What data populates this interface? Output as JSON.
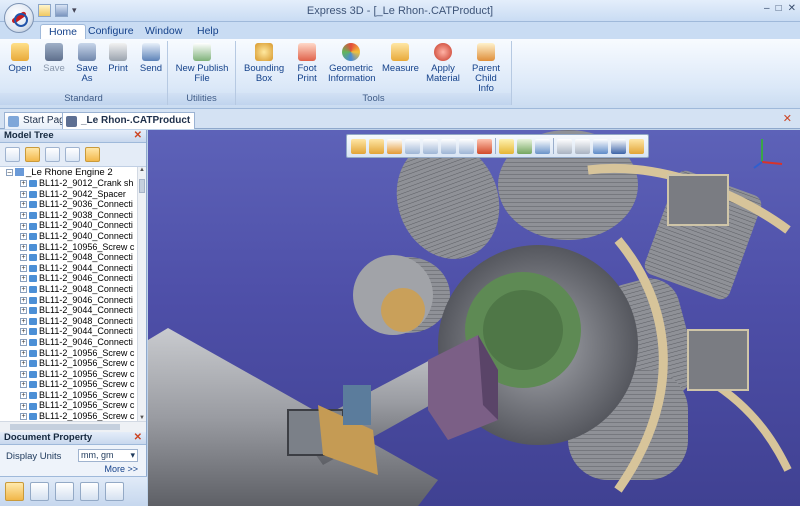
{
  "window": {
    "title": "Express 3D - [_Le Rhon-.CATProduct]",
    "controls": [
      "–",
      "□",
      "✕"
    ]
  },
  "ribbon_tabs": [
    "Home",
    "Configure",
    "Window",
    "Help"
  ],
  "ribbon": {
    "standard": {
      "label": "Standard",
      "buttons": [
        "Open",
        "Save",
        "Save As",
        "Print",
        "Send"
      ]
    },
    "utilities": {
      "label": "Utilities",
      "buttons": [
        "New Publish File"
      ]
    },
    "tools": {
      "label": "Tools",
      "buttons": [
        "Bounding Box",
        "Foot Print",
        "Geometric Information",
        "Measure",
        "Apply Material",
        "Parent Child Info"
      ]
    }
  },
  "doc_tabs": [
    "Start Page",
    "_Le Rhon-.CATProduct"
  ],
  "model_tree": {
    "title": "Model Tree",
    "root": "_Le Rhone Engine 2",
    "items": [
      "BL11-2_9012_Crank sh",
      "BL11-2_9042_Spacer",
      "BL11-2_9036_Connecti",
      "BL11-2_9038_Connecti",
      "BL11-2_9040_Connecti",
      "BL11-2_9040_Connecti",
      "BL11-2_10956_Screw c",
      "BL11-2_9048_Connecti",
      "BL11-2_9044_Connecti",
      "BL11-2_9046_Connecti",
      "BL11-2_9048_Connecti",
      "BL11-2_9046_Connecti",
      "BL11-2_9044_Connecti",
      "BL11-2_9048_Connecti",
      "BL11-2_9044_Connecti",
      "BL11-2_9046_Connecti",
      "BL11-2_10956_Screw c",
      "BL11-2_10956_Screw c",
      "BL11-2_10956_Screw c",
      "BL11-2_10956_Screw c",
      "BL11-2_10956_Screw c",
      "BL11-2_10956_Screw c",
      "BL11-2_10956_Screw c"
    ]
  },
  "document_property": {
    "title": "Document Property",
    "display_units_label": "Display Units",
    "display_units_value": "mm, gm",
    "more_label": "More >>"
  },
  "colors": {
    "viewport_bg": "#4e4fa8",
    "ribbon_bg": "#dbe8f8",
    "metal": "#8c8f96",
    "tan": "#d7c49a",
    "green_flange": "#5e8a54",
    "purple_box": "#7b5f86"
  }
}
